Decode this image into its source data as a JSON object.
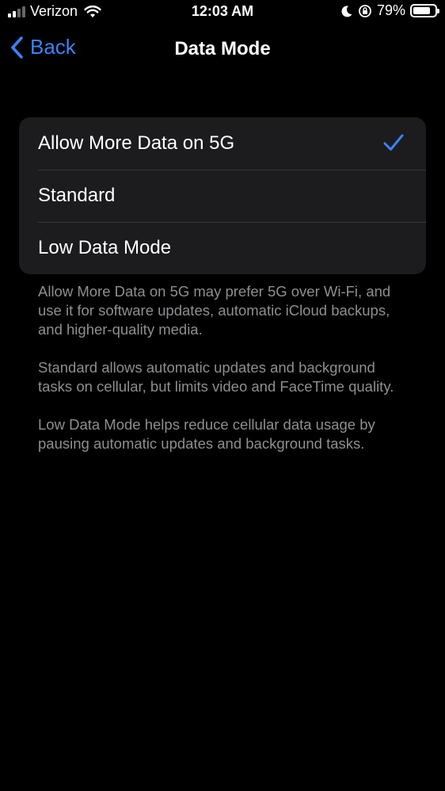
{
  "status_bar": {
    "carrier": "Verizon",
    "time": "12:03 AM",
    "battery_percent": "79%",
    "battery_level": 0.79,
    "icons": [
      "signal-icon",
      "wifi-icon",
      "moon-icon",
      "orientation-lock-icon",
      "battery-icon"
    ]
  },
  "nav": {
    "back_label": "Back",
    "title": "Data Mode"
  },
  "options": [
    {
      "label": "Allow More Data on 5G",
      "selected": true
    },
    {
      "label": "Standard",
      "selected": false
    },
    {
      "label": "Low Data Mode",
      "selected": false
    }
  ],
  "descriptions": [
    "Allow More Data on 5G may prefer 5G over Wi-Fi, and use it for software updates, automatic iCloud backups, and higher-quality media.",
    "Standard allows automatic updates and background tasks on cellular, but limits video and FaceTime quality.",
    "Low Data Mode helps reduce cellular data usage by pausing automatic updates and background tasks."
  ],
  "colors": {
    "accent": "#3b82f6",
    "background": "#000000",
    "group_background": "#1c1c1e",
    "secondary_text": "#8e8e93"
  }
}
